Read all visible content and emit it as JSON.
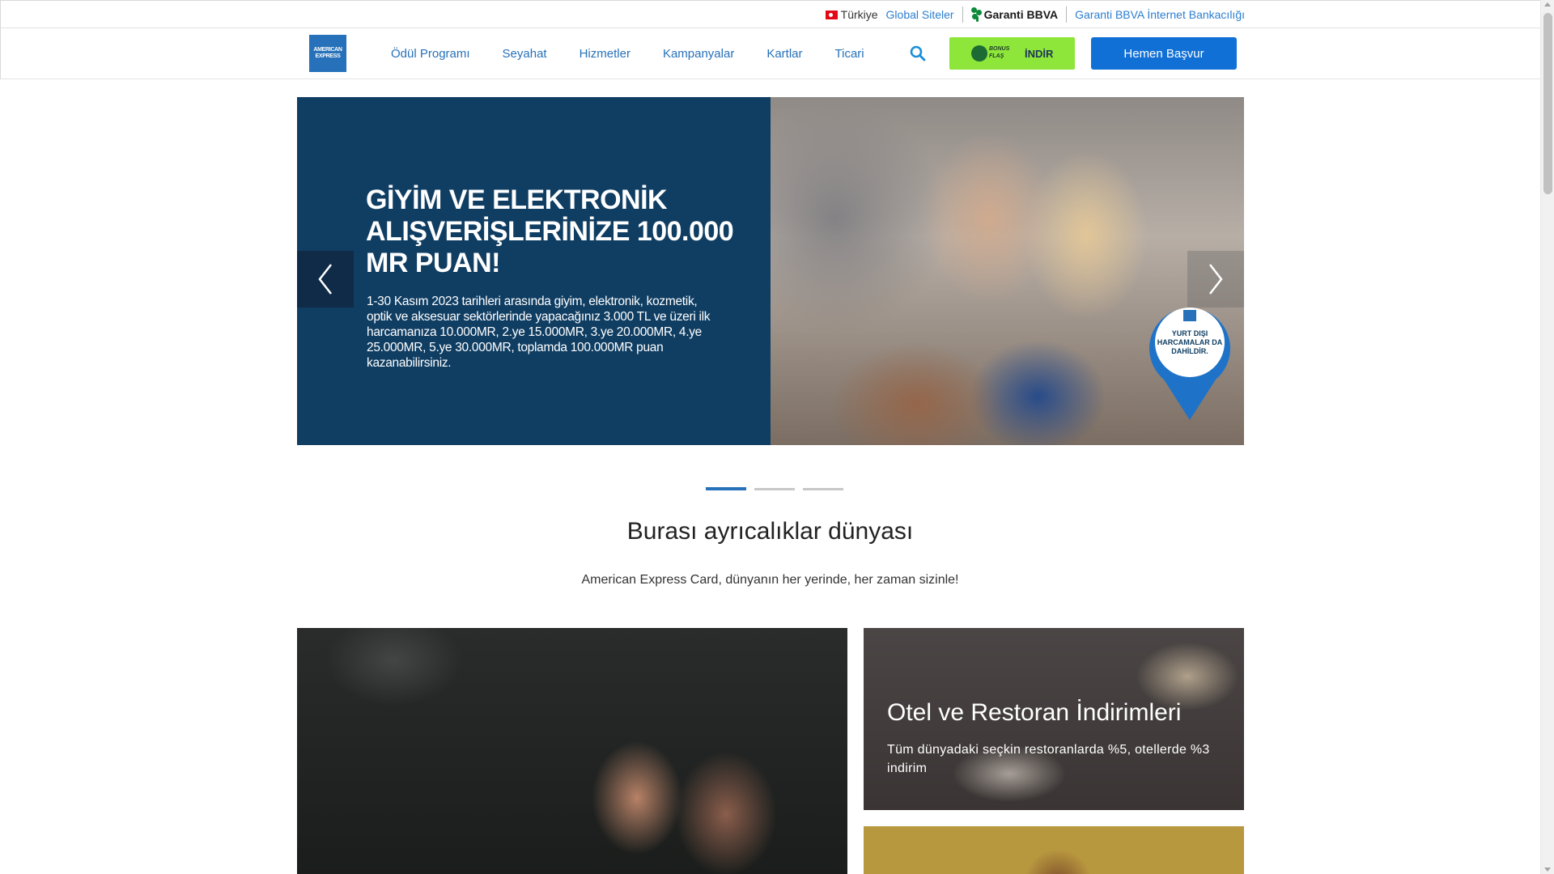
{
  "utility": {
    "country": "Türkiye",
    "global_sites": "Global Siteler",
    "garanti_brand": "Garanti BBVA",
    "internet_banking": "Garanti BBVA İnternet Bankacılığı"
  },
  "nav": {
    "logo_line1": "AMERICAN",
    "logo_line2": "EXPRESS",
    "items": [
      "Ödül Programı",
      "Seyahat",
      "Hizmetler",
      "Kampanyalar",
      "Kartlar",
      "Ticari"
    ],
    "bonus_logo_text": "BONUS FLAŞ",
    "bonus_label": "İNDİR",
    "apply_label": "Hemen Başvur"
  },
  "hero": {
    "title": "GİYİM VE ELEKTRONİK ALIŞVERİŞLERİNİZE 100.000 MR PUAN!",
    "text": "1-30 Kasım 2023 tarihleri arasında giyim, elektronik, kozmetik, optik ve aksesuar sektörlerinde yapacağınız 3.000 TL ve üzeri ilk harcamanıza 10.000MR, 2.ye 15.000MR, 3.ye 20.000MR, 4.ye 25.000MR, 5.ye 30.000MR, toplamda 100.000MR puan kazanabilirsiniz.",
    "badge_text": "YURT DIŞI HARCAMALAR DA DAHİLDİR.",
    "slides_total": 3,
    "active_slide": 1
  },
  "section": {
    "title": "Burası ayrıcalıklar dünyası",
    "subtitle": "American Express Card, dünyanın her yerinde, her zaman sizinle!"
  },
  "cards": {
    "hotel_title": "Otel ve Restoran İndirimleri",
    "hotel_text": "Tüm dünyadaki seçkin restoranlarda %5, otellerde %3 indirim"
  },
  "colors": {
    "brand_blue": "#2671b9",
    "hero_navy": "#103e63",
    "bonus_green": "#8ee63a",
    "apply_blue": "#1170d6"
  }
}
